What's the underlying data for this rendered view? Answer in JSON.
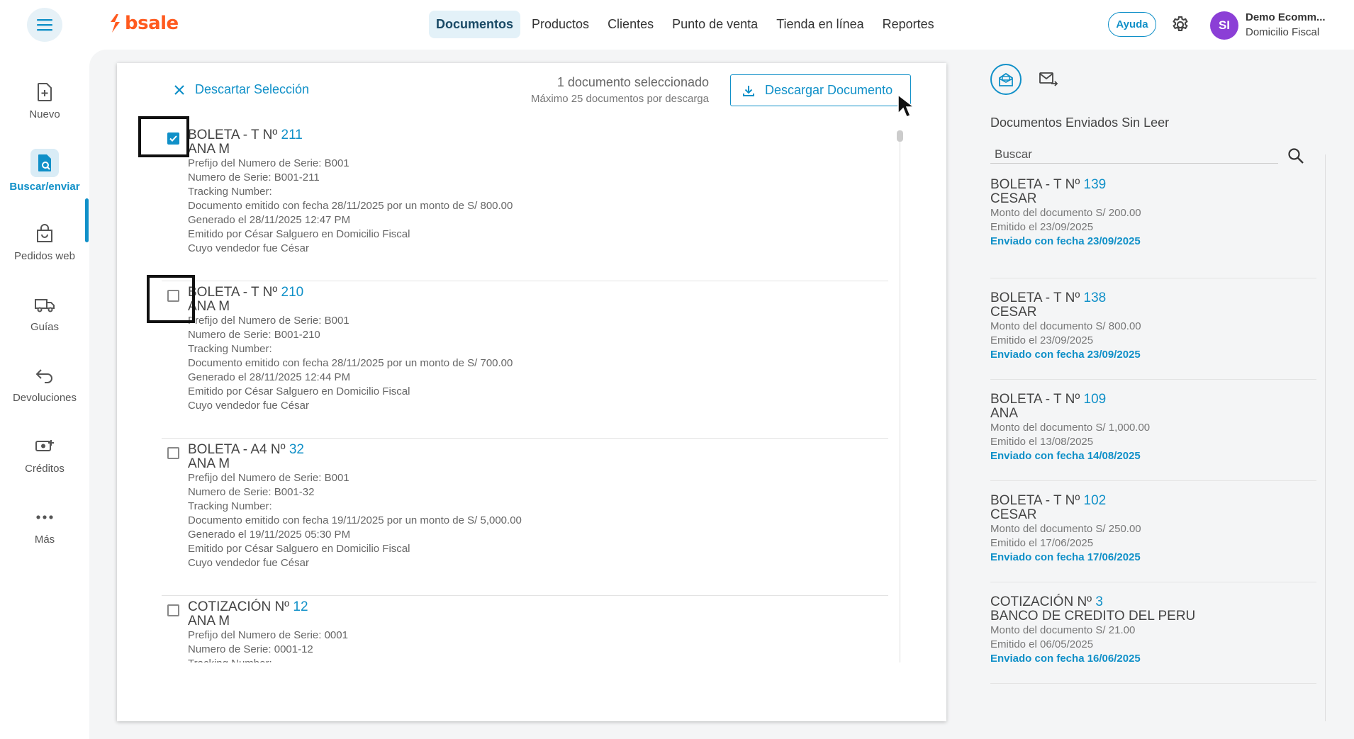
{
  "brand": {
    "name": "bsale",
    "color": "#ff5a1f"
  },
  "nav": {
    "items": [
      {
        "label": "Documentos",
        "active": true
      },
      {
        "label": "Productos"
      },
      {
        "label": "Clientes"
      },
      {
        "label": "Punto de venta"
      },
      {
        "label": "Tienda en línea"
      },
      {
        "label": "Reportes"
      }
    ]
  },
  "header": {
    "help_label": "Ayuda",
    "avatar_initials": "SI",
    "user_name": "Demo Ecomm...",
    "user_location": "Domicilio Fiscal"
  },
  "sidebar": {
    "items": [
      {
        "label": "Nuevo",
        "icon": "new-document-icon"
      },
      {
        "label": "Buscar/enviar",
        "icon": "search-document-icon",
        "active": true
      },
      {
        "label": "Pedidos web",
        "icon": "shopping-bag-icon"
      },
      {
        "label": "Guías",
        "icon": "truck-icon"
      },
      {
        "label": "Devoluciones",
        "icon": "return-arrow-icon"
      },
      {
        "label": "Créditos",
        "icon": "credit-icon"
      },
      {
        "label": "Más",
        "icon": "more-dots-icon"
      }
    ]
  },
  "selection": {
    "discard_label": "Descartar Selección",
    "count_text": "1 documento seleccionado",
    "limit_text": "Máximo 25 documentos por descarga",
    "download_label": "Descargar Documento"
  },
  "documents": [
    {
      "type": "BOLETA - T Nº",
      "number": "211",
      "client": "ANA M",
      "checked": true,
      "lines": [
        "Prefijo del Numero de Serie: B001",
        "Numero de Serie: B001-211",
        "Tracking Number:",
        "Documento emitido con fecha 28/11/2025 por un monto de S/ 800.00",
        "Generado el 28/11/2025 12:47 PM",
        "Emitido por César Salguero en Domicilio Fiscal",
        "Cuyo vendedor fue César"
      ]
    },
    {
      "type": "BOLETA - T Nº",
      "number": "210",
      "client": "ANA M",
      "checked": false,
      "lines": [
        "Prefijo del Numero de Serie: B001",
        "Numero de Serie: B001-210",
        "Tracking Number:",
        "Documento emitido con fecha 28/11/2025 por un monto de S/ 700.00",
        "Generado el 28/11/2025 12:44 PM",
        "Emitido por César Salguero en Domicilio Fiscal",
        "Cuyo vendedor fue César"
      ]
    },
    {
      "type": "BOLETA - A4 Nº",
      "number": "32",
      "client": "ANA M",
      "checked": false,
      "lines": [
        "Prefijo del Numero de Serie: B001",
        "Numero de Serie: B001-32",
        "Tracking Number:",
        "Documento emitido con fecha 19/11/2025 por un monto de S/ 5,000.00",
        "Generado el 19/11/2025 05:30 PM",
        "Emitido por César Salguero en Domicilio Fiscal",
        "Cuyo vendedor fue César"
      ]
    },
    {
      "type": "COTIZACIÓN Nº",
      "number": "12",
      "client": "ANA M",
      "checked": false,
      "lines": [
        "Prefijo del Numero de Serie: 0001",
        "Numero de Serie: 0001-12",
        "Tracking Number:"
      ]
    }
  ],
  "right_panel": {
    "title": "Documentos Enviados Sin Leer",
    "search_placeholder": "Buscar",
    "items": [
      {
        "type": "BOLETA - T Nº",
        "number": "139",
        "client": "CESAR",
        "amount": "Monto del documento S/ 200.00",
        "issued": "Emitido el 23/09/2025",
        "sent": "Enviado con fecha 23/09/2025"
      },
      {
        "type": "BOLETA - T Nº",
        "number": "138",
        "client": "CESAR",
        "amount": "Monto del documento S/ 800.00",
        "issued": "Emitido el 23/09/2025",
        "sent": "Enviado con fecha 23/09/2025"
      },
      {
        "type": "BOLETA - T Nº",
        "number": "109",
        "client": "ANA",
        "amount": "Monto del documento S/ 1,000.00",
        "issued": "Emitido el 13/08/2025",
        "sent": "Enviado con fecha 14/08/2025"
      },
      {
        "type": "BOLETA - T Nº",
        "number": "102",
        "client": "CESAR",
        "amount": "Monto del documento S/ 250.00",
        "issued": "Emitido el 17/06/2025",
        "sent": "Enviado con fecha 17/06/2025"
      },
      {
        "type": "COTIZACIÓN Nº",
        "number": "3",
        "client": "BANCO DE CREDITO DEL PERU",
        "amount": "Monto del documento S/ 21.00",
        "issued": "Emitido el 06/05/2025",
        "sent": "Enviado con fecha 16/06/2025"
      }
    ]
  },
  "colors": {
    "accent": "#1090c8",
    "avatar": "#8b3fd6"
  }
}
